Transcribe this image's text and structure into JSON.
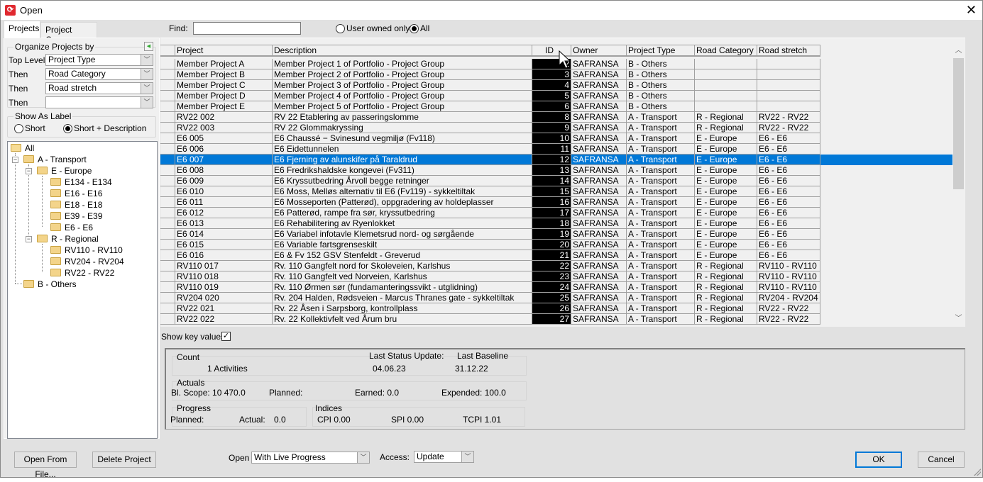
{
  "window": {
    "title": "Open",
    "close_glyph": "✕",
    "app_icon_glyph": "ഇ"
  },
  "tabs": [
    {
      "label": "Projects",
      "active": true
    },
    {
      "label": "Project Groups",
      "active": false
    }
  ],
  "organize": {
    "legend": "Organize Projects by",
    "rows": [
      {
        "label": "Top Level",
        "value": "Project Type"
      },
      {
        "label": "Then",
        "value": "Road Category"
      },
      {
        "label": "Then",
        "value": "Road stretch"
      },
      {
        "label": "Then",
        "value": ""
      }
    ]
  },
  "show_as_label": {
    "legend": "Show As Label",
    "options": [
      {
        "label": "Short",
        "selected": false
      },
      {
        "label": "Short + Description",
        "selected": true
      }
    ]
  },
  "tree": [
    {
      "label": "All",
      "level": 0
    },
    {
      "label": "A - Transport",
      "level": 1
    },
    {
      "label": "E - Europe",
      "level": 2
    },
    {
      "label": "E134 - E134",
      "level": 3
    },
    {
      "label": "E16 - E16",
      "level": 3
    },
    {
      "label": "E18 - E18",
      "level": 3
    },
    {
      "label": "E39 - E39",
      "level": 3
    },
    {
      "label": "E6 - E6",
      "level": 3
    },
    {
      "label": "R - Regional",
      "level": 2
    },
    {
      "label": "RV110 - RV110",
      "level": 3
    },
    {
      "label": "RV204 - RV204",
      "level": 3
    },
    {
      "label": "RV22 - RV22",
      "level": 3
    },
    {
      "label": "B - Others",
      "level": 1
    }
  ],
  "find": {
    "label": "Find:",
    "value": "",
    "placeholder": ""
  },
  "ownership": [
    {
      "label": "User owned only",
      "selected": false
    },
    {
      "label": "All",
      "selected": true
    }
  ],
  "grid": {
    "columns": [
      "",
      "Project",
      "Description",
      "ID",
      "Owner",
      "Project Type",
      "Road Category",
      "Road stretch"
    ],
    "selected_index": 9,
    "rows": [
      [
        "Member Project A",
        "Member Project 1 of Portfolio - Project Group",
        "2",
        "SAFRANSA",
        "B - Others",
        "",
        ""
      ],
      [
        "Member Project B",
        "Member Project 2 of Portfolio - Project Group",
        "3",
        "SAFRANSA",
        "B - Others",
        "",
        ""
      ],
      [
        "Member Project C",
        "Member Project 3 of Portfolio - Project Group",
        "4",
        "SAFRANSA",
        "B - Others",
        "",
        ""
      ],
      [
        "Member Project D",
        "Member Project 4 of Portfolio - Project Group",
        "5",
        "SAFRANSA",
        "B - Others",
        "",
        ""
      ],
      [
        "Member Project E",
        "Member Project 5 of Portfolio - Project Group",
        "6",
        "SAFRANSA",
        "B - Others",
        "",
        ""
      ],
      [
        "RV22 002",
        "RV 22 Etablering av passeringslomme",
        "8",
        "SAFRANSA",
        "A - Transport",
        "R - Regional",
        "RV22 - RV22"
      ],
      [
        "RV22 003",
        "RV 22 Glommakryssing",
        "9",
        "SAFRANSA",
        "A - Transport",
        "R - Regional",
        "RV22 - RV22"
      ],
      [
        "E6 005",
        "E6 Chaussé − Svinesund vegmiljø (Fv118)",
        "10",
        "SAFRANSA",
        "A - Transport",
        "E - Europe",
        "E6 - E6"
      ],
      [
        "E6 006",
        "E6 Eidettunnelen",
        "11",
        "SAFRANSA",
        "A - Transport",
        "E - Europe",
        "E6 - E6"
      ],
      [
        "E6 007",
        "E6 Fjerning av alunskifer på Taraldrud",
        "12",
        "SAFRANSA",
        "A - Transport",
        "E - Europe",
        "E6 - E6"
      ],
      [
        "E6 008",
        "E6 Fredrikshaldske kongevei (Fv311)",
        "13",
        "SAFRANSA",
        "A - Transport",
        "E - Europe",
        "E6 - E6"
      ],
      [
        "E6 009",
        "E6 Kryssutbedring Årvoll begge retninger",
        "14",
        "SAFRANSA",
        "A - Transport",
        "E - Europe",
        "E6 - E6"
      ],
      [
        "E6 010",
        "E6 Moss, Melløs alternativ til E6 (Fv119) - sykkeltiltak",
        "15",
        "SAFRANSA",
        "A - Transport",
        "E - Europe",
        "E6 - E6"
      ],
      [
        "E6 011",
        "E6 Mosseporten (Patterød), oppgradering av holdeplasser",
        "16",
        "SAFRANSA",
        "A - Transport",
        "E - Europe",
        "E6 - E6"
      ],
      [
        "E6 012",
        "E6 Patterød, rampe fra sør, kryssutbedring",
        "17",
        "SAFRANSA",
        "A - Transport",
        "E - Europe",
        "E6 - E6"
      ],
      [
        "E6 013",
        "E6 Rehabilitering av Ryenlokket",
        "18",
        "SAFRANSA",
        "A - Transport",
        "E - Europe",
        "E6 - E6"
      ],
      [
        "E6 014",
        "E6 Variabel infotavle Klemetsrud nord- og sørgående",
        "19",
        "SAFRANSA",
        "A - Transport",
        "E - Europe",
        "E6 - E6"
      ],
      [
        "E6 015",
        "E6 Variable fartsgrenseskilt",
        "20",
        "SAFRANSA",
        "A - Transport",
        "E - Europe",
        "E6 - E6"
      ],
      [
        "E6 016",
        "E6 & Fv 152 GSV Stenfeldt - Greverud",
        "21",
        "SAFRANSA",
        "A - Transport",
        "E - Europe",
        "E6 - E6"
      ],
      [
        "RV110 017",
        "Rv. 110 Gangfelt nord for Skoleveien, Karlshus",
        "22",
        "SAFRANSA",
        "A - Transport",
        "R - Regional",
        "RV110 - RV110"
      ],
      [
        "RV110 018",
        "Rv. 110 Gangfelt ved Norveien, Karlshus",
        "23",
        "SAFRANSA",
        "A - Transport",
        "R - Regional",
        "RV110 - RV110"
      ],
      [
        "RV110 019",
        "Rv. 110 Ørmen sør (fundamanteringssvikt - utglidning)",
        "24",
        "SAFRANSA",
        "A - Transport",
        "R - Regional",
        "RV110 - RV110"
      ],
      [
        "RV204 020",
        "Rv. 204 Halden, Rødsveien - Marcus Thranes gate - sykkeltiltak",
        "25",
        "SAFRANSA",
        "A - Transport",
        "R - Regional",
        "RV204 - RV204"
      ],
      [
        "RV22 021",
        "Rv. 22 Åsen i Sarpsborg, kontrollplass",
        "26",
        "SAFRANSA",
        "A - Transport",
        "R - Regional",
        "RV22 - RV22"
      ],
      [
        "RV22 022",
        "Rv. 22 Kollektivfelt ved Årum bru",
        "27",
        "SAFRANSA",
        "A - Transport",
        "R - Regional",
        "RV22 - RV22"
      ]
    ]
  },
  "show_key_values": {
    "label": "Show key values",
    "checked": true
  },
  "summary": {
    "count_title": "Count",
    "count_value": "1 Activities",
    "last_status_label": "Last Status Update:",
    "last_status_value": "04.06.23",
    "last_baseline_label": "Last Baseline",
    "last_baseline_value": "31.12.22",
    "actuals_title": "Actuals",
    "bl_scope": "Bl. Scope: 10 470.0",
    "planned": "Planned:",
    "earned": "Earned: 0.0",
    "expended": "Expended: 100.0",
    "progress_title": "Progress",
    "progress_planned": "Planned:",
    "progress_actual_label": "Actual:",
    "progress_actual_value": "0.0",
    "indices_title": "Indices",
    "cpi": "CPI  0.00",
    "spi": "SPI 0.00",
    "tcpi": "TCPI  1.01"
  },
  "footer": {
    "open_from_file": "Open From File...",
    "delete_project": "Delete Project",
    "open_label": "Open",
    "open_value": "With Live Progress",
    "access_label": "Access:",
    "access_value": "Update",
    "ok": "OK",
    "cancel": "Cancel"
  }
}
